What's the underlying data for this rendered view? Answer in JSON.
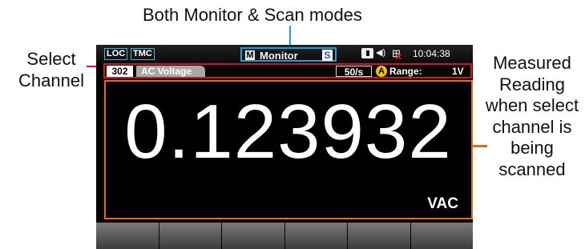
{
  "annotations": {
    "top": "Both Monitor & Scan modes",
    "left": "Select Channel",
    "right": "Measured Reading when select channel is being scanned"
  },
  "status_bar": {
    "loc": "LOC",
    "tmc": "TMC",
    "m_chip": "M",
    "mode": "Monitor",
    "s_chip": "S",
    "clock": "10:04:38"
  },
  "channel_row": {
    "channel": "302",
    "function": "AC Voltage",
    "rate": "50/s",
    "auto_icon": "A",
    "range_label": "Range:",
    "range_value": "1V"
  },
  "reading": {
    "value": "0.123932",
    "unit": "VAC"
  },
  "softkeys": 6,
  "colors": {
    "mode_box": "#1f9fdc",
    "channel_highlight": "#e0111b",
    "reading_highlight": "#e06a16",
    "auto_icon": "#f2c200"
  },
  "icons": [
    "memory-icon",
    "speaker-icon",
    "network-icon",
    "disconnected-x-icon"
  ]
}
